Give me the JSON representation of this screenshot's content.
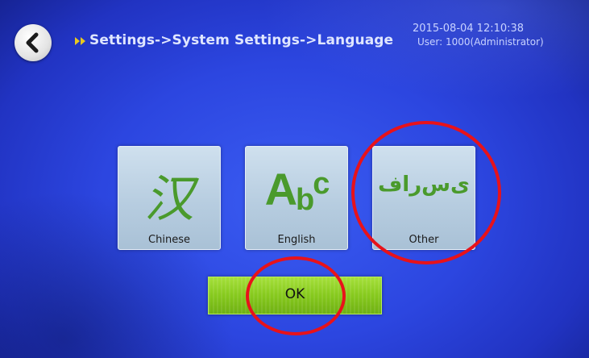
{
  "header": {
    "breadcrumb": "Settings->System Settings->Language",
    "datetime": "2015-08-04   12:10:38",
    "user": "User: 1000(Administrator)"
  },
  "languages": [
    {
      "label": "Chinese",
      "glyph": "汉"
    },
    {
      "label": "English",
      "glyph_main": "A",
      "glyph_sub": "b",
      "glyph_sup": "c"
    },
    {
      "label": "Other",
      "glyph": "ﻯﺱﺭﺍﻑ"
    }
  ],
  "ok_button": {
    "label": "OK"
  },
  "colors": {
    "background": "#2c46e0",
    "tile": "#b7cde0",
    "glyph_green": "#4a9a2c",
    "ok_green": "#86c91d",
    "annotation_red": "#e8121a"
  },
  "icons": {
    "back": "chevron-left-icon",
    "breadcrumb_marker": "double-arrow-icon"
  }
}
